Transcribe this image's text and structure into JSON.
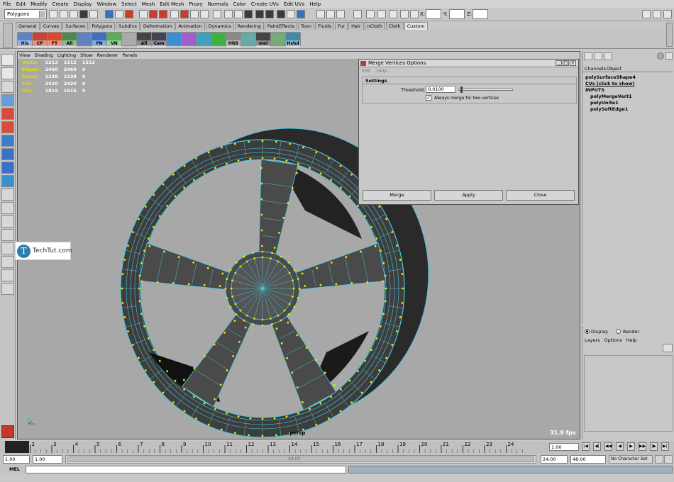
{
  "menubar": [
    "File",
    "Edit",
    "Modify",
    "Create",
    "Display",
    "Window",
    "Select",
    "Mesh",
    "Edit Mesh",
    "Proxy",
    "Normals",
    "Color",
    "Create UVs",
    "Edit UVs",
    "Help"
  ],
  "status": {
    "mode": "Polygons",
    "x_label": "X:",
    "y_label": "Y:",
    "z_label": "Z:"
  },
  "shelf_tabs": [
    "General",
    "Curves",
    "Surfaces",
    "Polygons",
    "Subdivs",
    "Deformation",
    "Animation",
    "Dynamics",
    "Rendering",
    "PaintEffects",
    "Toon",
    "Fluids",
    "Fur",
    "Hair",
    "nCloth",
    "Cloth",
    "Custom"
  ],
  "shelf_active": "Custom",
  "shelf_buttons": [
    "His",
    "CP",
    "FT",
    "All",
    "",
    "FN",
    "VN",
    "",
    "All",
    "Cam",
    "",
    "",
    "",
    "",
    "HRB",
    "",
    "mel",
    "",
    "Hshd"
  ],
  "viewport": {
    "menu": [
      "View",
      "Shading",
      "Lighting",
      "Show",
      "Renderer",
      "Panels"
    ],
    "hud": [
      {
        "label": "Verts:",
        "a": "1212",
        "b": "1212",
        "c": "1212"
      },
      {
        "label": "Edges:",
        "a": "2460",
        "b": "2460",
        "c": "0"
      },
      {
        "label": "Faces:",
        "a": "1238",
        "b": "1238",
        "c": "0"
      },
      {
        "label": "Tris:",
        "a": "2420",
        "b": "2420",
        "c": "0"
      },
      {
        "label": "UVs:",
        "a": "1815",
        "b": "1815",
        "c": "0"
      }
    ],
    "camera": "persp",
    "fps": "31.9 fps",
    "watermark": "TechTut.com"
  },
  "dialog": {
    "title": "Merge Vertices Options",
    "menu": [
      "Edit",
      "Help"
    ],
    "section": "Settings",
    "threshold_label": "Threshold:",
    "threshold_value": "0.0100",
    "slider_fraction": 0.03,
    "checkbox_label": "Always merge for two vertices",
    "checkbox_checked": true,
    "buttons": {
      "merge": "Merge",
      "apply": "Apply",
      "close": "Close"
    }
  },
  "channelbox": {
    "tabs": [
      "Channels",
      "Object"
    ],
    "shape": "polySurfaceShape4",
    "cvs": "CVs (click to show)",
    "inputs_label": "INPUTS",
    "inputs": [
      "polyMergeVert1",
      "polyUnite1",
      "polySoftEdge1"
    ]
  },
  "layers": {
    "display": "Display",
    "render": "Render",
    "menu": [
      "Layers",
      "Options",
      "Help"
    ]
  },
  "timeline": {
    "ticks": [
      "1",
      "2",
      "3",
      "4",
      "5",
      "6",
      "7",
      "8",
      "9",
      "10",
      "11",
      "12",
      "13",
      "14",
      "15",
      "16",
      "17",
      "18",
      "19",
      "20",
      "21",
      "22",
      "23",
      "24"
    ],
    "current_frame": "1.00",
    "start": "1.00",
    "inner_start": "1.00",
    "range_end_label": "24.00",
    "end": "24.00",
    "anim_end": "48.00",
    "character_set": "No Character Set"
  },
  "cmd": {
    "label": "MEL"
  }
}
